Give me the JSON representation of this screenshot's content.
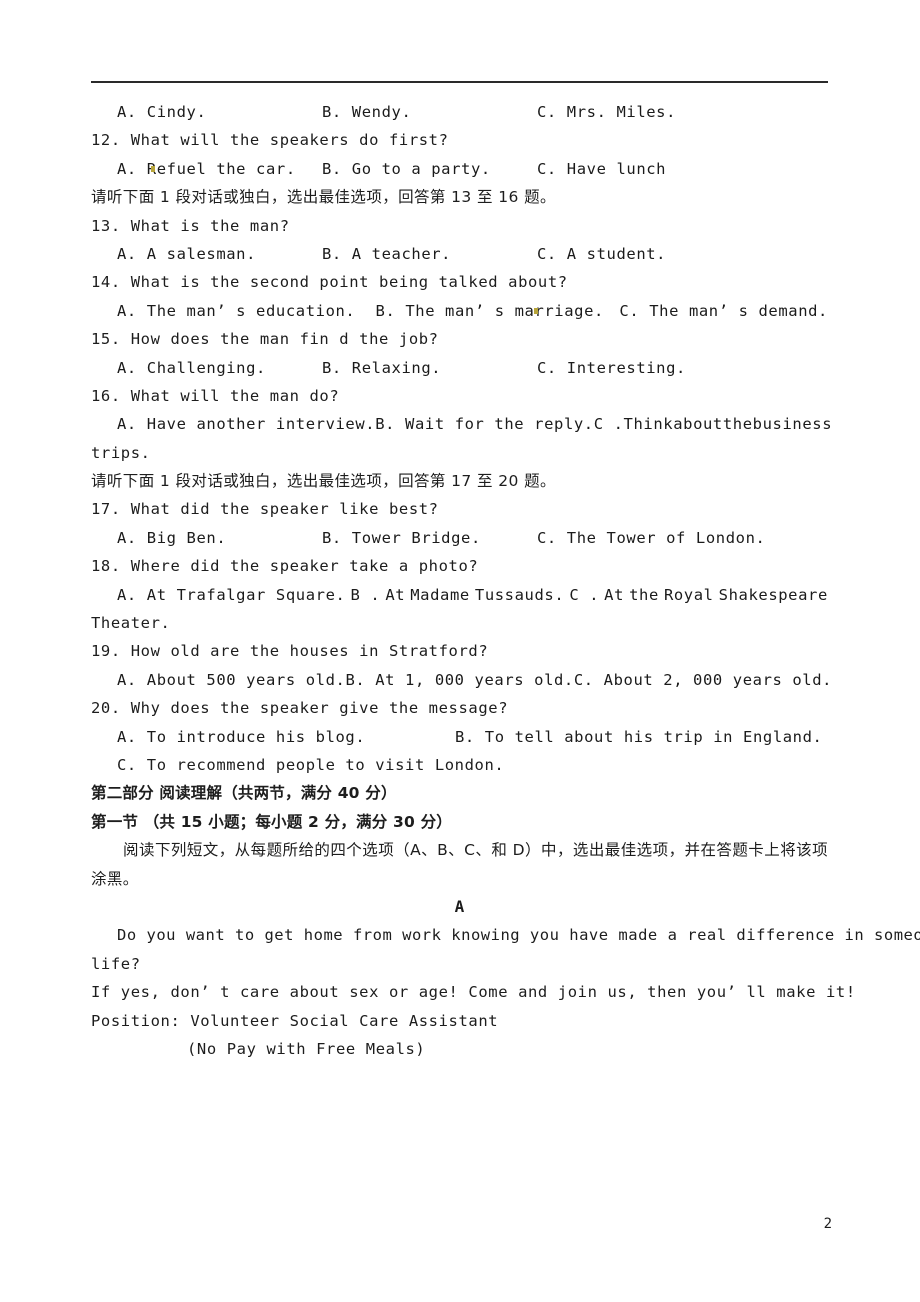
{
  "page": {
    "number": "2",
    "has_header_rule": true
  },
  "listening": {
    "q11_options": {
      "a": "A. Cindy.",
      "b": "B. Wendy.",
      "c": "C. Mrs. Miles."
    },
    "q12": {
      "stem": "12. What will the speakers do first?",
      "a": "A. Refuel the car.",
      "b": "B. Go to a party.",
      "c": "C. Have lunch"
    },
    "instruction_13_16": "请听下面 1 段对话或独白，选出最佳选项，回答第 13 至 16 题。",
    "q13": {
      "stem": "13. What is the man?",
      "a": "A. A salesman.",
      "b": "B. A teacher.",
      "c": "C. A student."
    },
    "q14": {
      "stem": "14. What is the second point being talked about?",
      "a": "A. The man’ s education.",
      "b": "B. The man’ s marriage.",
      "c": "C. The man’ s demand."
    },
    "q15": {
      "stem": "15. How does the man fin d the job?",
      "a": "A. Challenging.",
      "b": "B. Relaxing.",
      "c": "C. Interesting."
    },
    "q16": {
      "stem": "16. What will the man do?",
      "a": "A. Have another interview.",
      "b": "B. Wait for the reply.",
      "c1": "C .",
      "c2": "Think",
      "c3": "about",
      "c4": "the",
      "c5": "business",
      "c_wrap": "trips."
    },
    "instruction_17_20": "请听下面 1 段对话或独白，选出最佳选项，回答第 17 至 20 题。",
    "q17": {
      "stem": "17. What did the speaker like best?",
      "a": "A. Big Ben.",
      "b": "B. Tower Bridge.",
      "c": "C. The Tower of London."
    },
    "q18": {
      "stem": "18. Where did the speaker take a photo?",
      "a": "A. At Trafalgar Square.",
      "b1": "B .",
      "b2": "At",
      "b3": "Madame",
      "b4": "Tussauds.",
      "c1": "C .",
      "c2": "At",
      "c3": "the",
      "c4": "Royal",
      "c5": "Shakespeare",
      "c_wrap": "Theater."
    },
    "q19": {
      "stem": "19. How old are the houses in Stratford?",
      "a": "A. About 500 years old.",
      "b": "B. At 1, 000 years old.",
      "c": "C. About 2, 000 years old."
    },
    "q20": {
      "stem": "20. Why does the speaker give the message?",
      "a": "A. To introduce his blog.",
      "b": "B. To tell about his trip in England.",
      "c": "C. To recommend people to visit London."
    }
  },
  "reading": {
    "part_heading": "第二部分 阅读理解（共两节，满分 40 分）",
    "section_heading": "第一节 （共 15 小题；每小题 2 分，满分 30 分）",
    "directions": "阅读下列短文，从每题所给的四个选项（A、B、C、和 D）中，选出最佳选项，并在答题卡上将该项涂黑。",
    "passage_label": "A",
    "passage": {
      "line1": "Do you want to get home from work knowing you have made a real difference in someone’ s",
      "line1_wrap": "life?",
      "line2": "If yes, don’ t care about sex or age! Come and join us, then you’ ll make it!",
      "line3": "Position: Volunteer Social Care Assistant",
      "line4": "(No Pay with Free Meals)"
    }
  },
  "colors": {
    "text": "#1d1d1d",
    "rule": "#2a2a2a",
    "background": "#ffffff",
    "speck": "#b8a53a"
  }
}
